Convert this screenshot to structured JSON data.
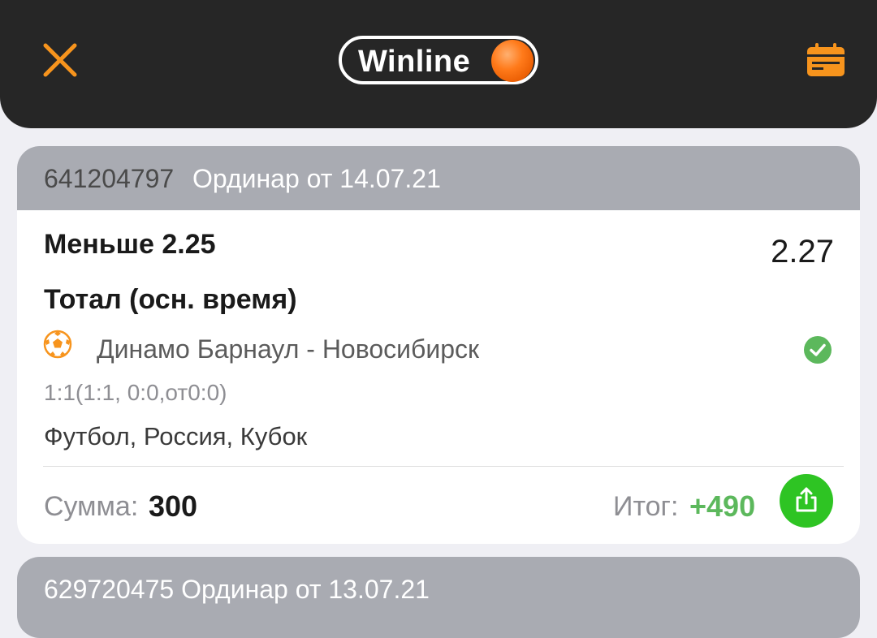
{
  "header": {
    "logo_text": "Winline",
    "accent_color": "#f7941d",
    "icons": {
      "close": "close-icon",
      "calendar": "calendar-icon"
    }
  },
  "bet": {
    "id": "641204797",
    "type_date": "Ординар от 14.07.21",
    "outcome": "Меньше 2.25",
    "odds": "2.27",
    "market": "Тотал (осн. время)",
    "sport_icon": "soccer-ball-icon",
    "match": "Динамо Барнаул - Новосибирск",
    "status_icon": "check-circle-icon",
    "status_color": "#5cb85c",
    "score": "1:1(1:1, 0:0,от0:0)",
    "league": "Футбол, Россия, Кубок",
    "stake_label": "Сумма:",
    "stake_value": "300",
    "result_label": "Итог:",
    "result_value": "+490",
    "share_icon": "share-icon"
  },
  "next_bet": {
    "partial_text": "629720475 Ординар от 13.07.21"
  }
}
